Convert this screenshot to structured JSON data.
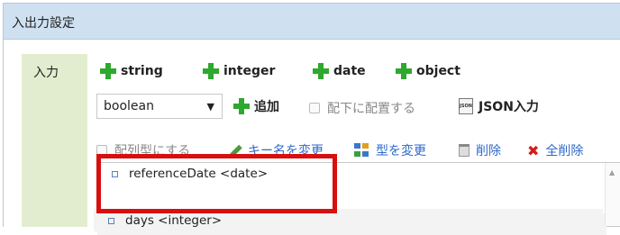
{
  "panel": {
    "title": "入出力設定",
    "section_label": "入力"
  },
  "type_buttons": [
    {
      "label": "string"
    },
    {
      "label": "integer"
    },
    {
      "label": "date"
    },
    {
      "label": "object"
    }
  ],
  "type_select": {
    "value": "boolean",
    "arrow": "▼"
  },
  "add_button": {
    "label": "追加"
  },
  "place_under_checkbox": {
    "label": "配下に配置する",
    "checked": false
  },
  "json_input_button": {
    "label": "JSON入力",
    "icon_text": "JSON"
  },
  "array_checkbox": {
    "label": "配列型にする",
    "checked": false
  },
  "actions": {
    "rename_key": "キー名を変更",
    "change_type": "型を変更",
    "delete": "削除",
    "delete_all": "全削除"
  },
  "tree": {
    "items": [
      {
        "label": "referenceDate <date>"
      },
      {
        "label": "days <integer>"
      }
    ]
  },
  "colors": {
    "header_bg": "#cfe1f0",
    "label_bg": "#e2edcf",
    "plus_green": "#2ea82e",
    "link_blue": "#2f69c9",
    "highlight_red": "#d80f0f"
  }
}
